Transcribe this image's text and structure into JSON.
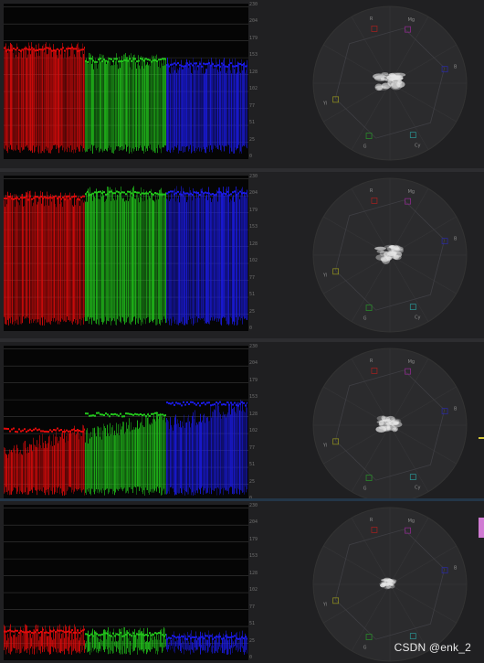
{
  "scale_labels": [
    "0",
    "25",
    "51",
    "77",
    "102",
    "128",
    "153",
    "179",
    "204",
    "230"
  ],
  "vectorscope_labels": [
    "R",
    "Mg",
    "B",
    "Cy",
    "G",
    "Yl"
  ],
  "panels": [
    {
      "name": "panel-1",
      "red_level": 0.7,
      "green_level": 0.63,
      "blue_level": 0.6
    },
    {
      "name": "panel-2",
      "red_level": 0.85,
      "green_level": 0.88,
      "blue_level": 0.88
    },
    {
      "name": "panel-3",
      "red_level": 0.45,
      "green_level": 0.55,
      "blue_level": 0.62
    },
    {
      "name": "panel-4",
      "red_level": 0.18,
      "green_level": 0.16,
      "blue_level": 0.14
    }
  ],
  "colors": {
    "red": "#e00b0b",
    "green": "#22c51c",
    "blue": "#1b1be6",
    "accent_yellow": "#d7c93a",
    "accent_pink": "#d07bd3"
  },
  "watermark": "CSDN @enk_2"
}
